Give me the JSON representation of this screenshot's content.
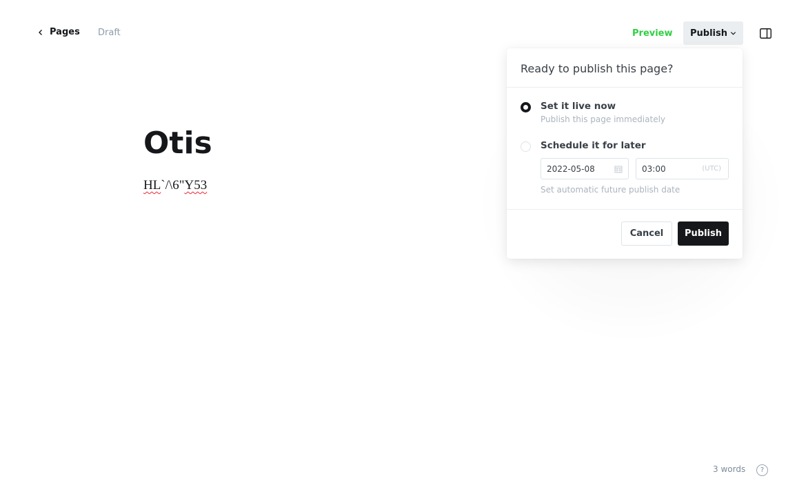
{
  "header": {
    "back_label": "Pages",
    "status": "Draft",
    "preview_label": "Preview",
    "publish_label": "Publish"
  },
  "editor": {
    "title": "Otis",
    "body_parts": [
      "HL",
      "`/\\6\"",
      "Y53"
    ]
  },
  "publish_popover": {
    "heading": "Ready to publish this page?",
    "options": [
      {
        "label": "Set it live now",
        "description": "Publish this page immediately",
        "selected": true
      },
      {
        "label": "Schedule it for later",
        "selected": false
      }
    ],
    "schedule": {
      "date": "2022-05-08",
      "time": "03:00",
      "timezone": "(UTC)",
      "hint": "Set automatic future publish date"
    },
    "cancel_label": "Cancel",
    "confirm_label": "Publish"
  },
  "footer": {
    "word_count": "3 words",
    "help_symbol": "?"
  },
  "colors": {
    "accent_green": "#30cf43",
    "primary_dark": "#15171a",
    "muted": "#8e9cac"
  }
}
